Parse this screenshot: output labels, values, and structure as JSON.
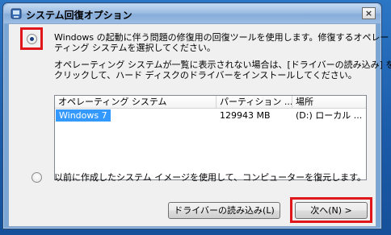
{
  "window": {
    "title": "システム回復オプション",
    "close_label": "×"
  },
  "option1": {
    "text_line1": "Windows の起動に伴う問題の修復用の回復ツールを使用します。修復するオペレー",
    "text_line2": "ティング システムを選択してください。",
    "selected": true
  },
  "info": {
    "line1": "オペレーティング システムが一覧に表示されない場合は、[ドライバーの読み込み] を",
    "line2": "クリックして、ハード ディスクのドライバーをインストールしてください。"
  },
  "os_list": {
    "columns": [
      "オペレーティング システム",
      "パーティション ...",
      "場所"
    ],
    "rows": [
      {
        "os": "Windows 7",
        "size": "129943 MB",
        "location": "(D:) ローカル ..."
      }
    ]
  },
  "option2": {
    "text": "以前に作成したシステム イメージを使用して、コンピューターを復元します。",
    "selected": false
  },
  "buttons": {
    "load_driver": "ドライバーの読み込み(L)",
    "next": "次へ(N) >"
  },
  "colors": {
    "highlight": "#e0161b",
    "selection": "#3399ff"
  }
}
